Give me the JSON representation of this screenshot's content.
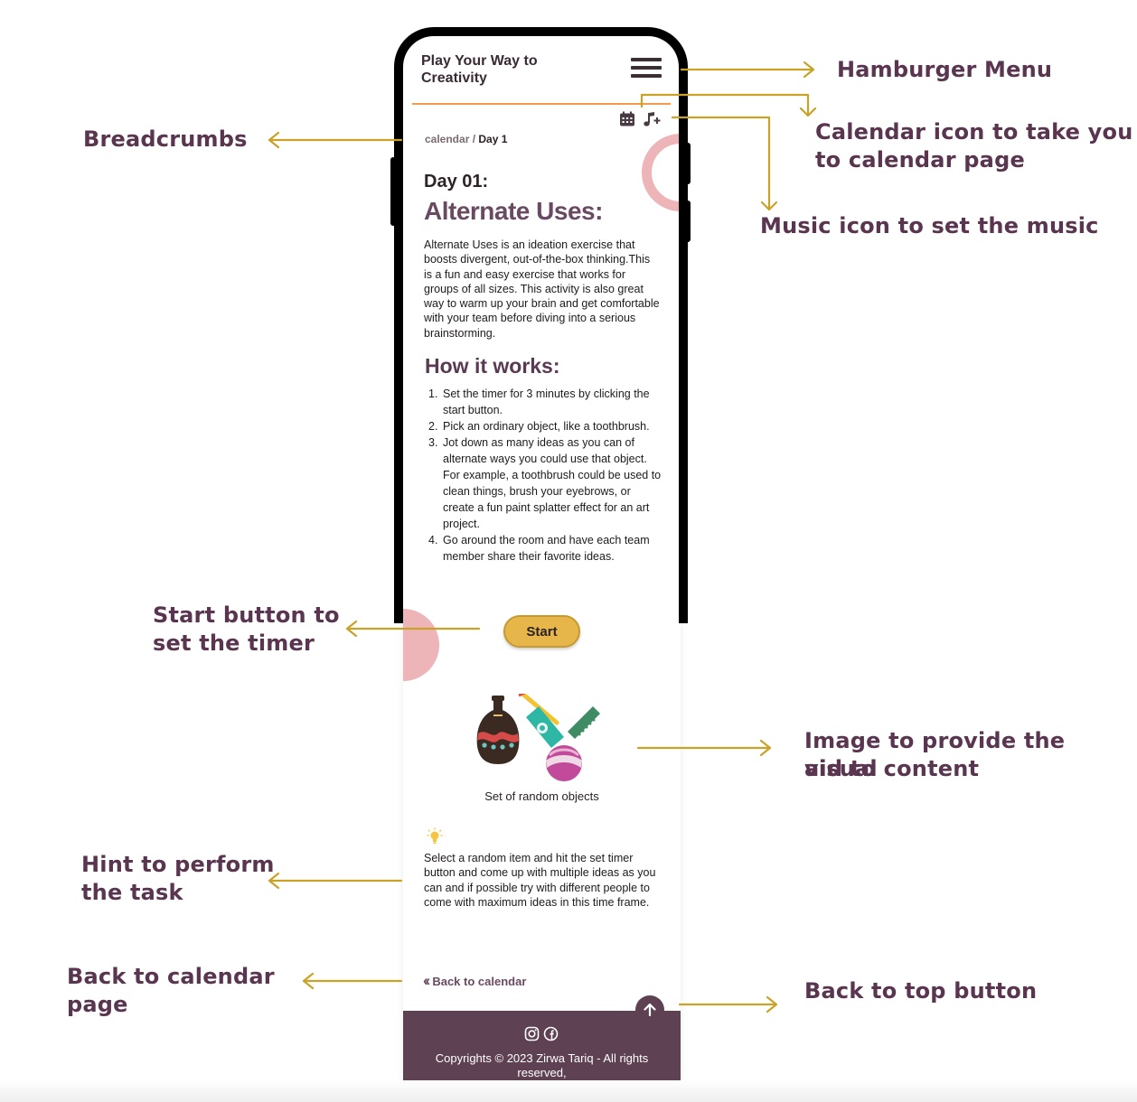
{
  "app": {
    "brand": "Play Your Way to Creativity"
  },
  "breadcrumb": {
    "parent": "calendar",
    "separator": "/",
    "current": "Day 1"
  },
  "content": {
    "day_title": "Day 01:",
    "activity_title": "Alternate Uses:",
    "intro": "Alternate Uses is an ideation exercise that boosts divergent, out-of-the-box thinking.This is a fun and easy exercise that works for groups of all sizes. This activity is also great way to warm up your brain and get comfortable with your team before diving into a serious brainstorming.",
    "how_title": "How it works:",
    "steps": [
      {
        "num": "1.",
        "text": "Set the timer for 3 minutes by clicking the start button."
      },
      {
        "num": "2.",
        "text": "Pick an ordinary object, like a toothbrush."
      },
      {
        "num": "3.",
        "text": "Jot down as many ideas as you can of alternate ways you could use that object. For example, a toothbrush could be used to clean things, brush your eyebrows, or create a fun paint splatter effect for an art project."
      },
      {
        "num": "4.",
        "text": "Go around the room and have each team member share their favorite ideas."
      }
    ],
    "start_label": "Start",
    "image_caption": "Set of random objects",
    "hint": "Select a random item and hit the set timer button and come up with multiple ideas as you can and if possible try with different people to come with maximum ideas in this time frame.",
    "back_label": "Back to calendar"
  },
  "footer": {
    "copyright": "Copyrights © 2023 Zirwa Tariq - All rights reserved,"
  },
  "icons": {
    "menu": "hamburger-menu-icon",
    "calendar": "calendar-icon",
    "music": "music-plus-icon",
    "hint": "lightbulb-icon",
    "back": "double-chevron-left-icon",
    "top": "arrow-up-icon",
    "social": [
      "instagram-icon",
      "facebook-icon"
    ]
  },
  "annotations": {
    "hamburger": "Hamburger Menu",
    "calendar_line1": "Calendar icon to take you",
    "calendar_line2": "to calendar page",
    "music": "Music icon to set the music",
    "breadcrumbs": "Breadcrumbs",
    "start_line1": "Start button to",
    "start_line2": "set the timer",
    "image_line1": "Image to provide the visual",
    "image_line2": "aid to content",
    "hint_line1": "Hint to perform",
    "hint_line2": "the task",
    "back_line1": "Back to calendar",
    "back_line2": "page",
    "top": "Back to top button"
  },
  "colors": {
    "brand_purple": "#5e4152",
    "title_purple": "#6a4a63",
    "accent_gold": "#e7b64a",
    "arrow_gold": "#c9a227",
    "header_line": "#f39a4d",
    "deco_pink": "#edb5b8"
  }
}
